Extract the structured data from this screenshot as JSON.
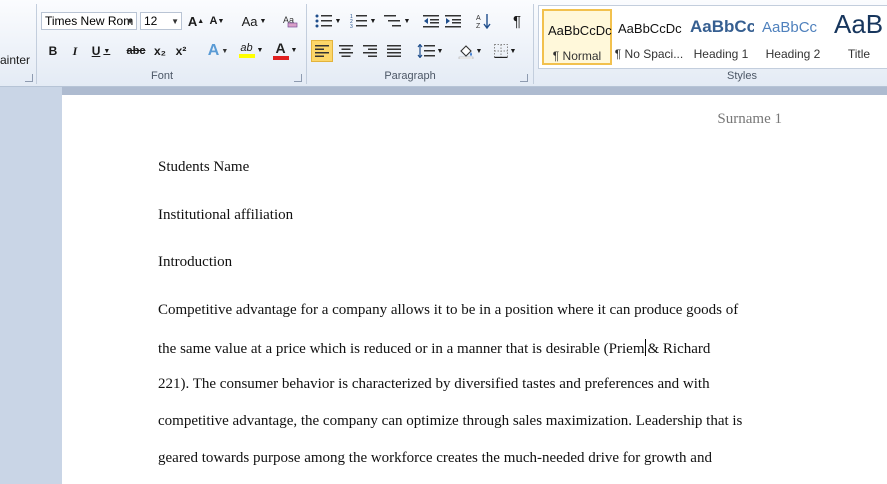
{
  "ribbon": {
    "clipboard_fragment": "ainter",
    "font": {
      "group_label": "Font",
      "font_name": "Times New Rom",
      "font_size": "12",
      "grow_font": "A",
      "shrink_font": "A",
      "change_case": "Aa",
      "bold": "B",
      "italic": "I",
      "underline": "U",
      "strikethrough": "abc",
      "subscript": "x₂",
      "superscript": "x²",
      "text_effects": "A",
      "highlight": "ab",
      "font_color": "A"
    },
    "paragraph": {
      "group_label": "Paragraph",
      "show_marks": "¶"
    },
    "styles": {
      "group_label": "Styles",
      "items": [
        {
          "sample": "AaBbCcDc",
          "name": "¶ Normal"
        },
        {
          "sample": "AaBbCcDc",
          "name": "¶ No Spaci..."
        },
        {
          "sample": "AaBbCc",
          "name": "Heading 1"
        },
        {
          "sample": "AaBbCc",
          "name": "Heading 2"
        },
        {
          "sample": "AaB",
          "name": "Title"
        }
      ]
    }
  },
  "colors": {
    "highlight": "#ffff00",
    "font_color": "#e02020",
    "heading": "#365f91",
    "selected_style": "#f2c14e"
  },
  "document": {
    "header": "Surname 1",
    "lines": [
      "Students Name",
      "Institutional affiliation",
      "Introduction",
      "Competitive advantage for a company allows it to be in a position where it can produce goods of",
      "the same value at a price which is reduced or in a manner that is desirable (Priem",
      "& Richard",
      "221). The consumer behavior is characterized by diversified tastes and preferences and with",
      "competitive advantage, the company can optimize through sales maximization.  Leadership that is",
      "geared towards purpose among the workforce creates the much-needed drive for growth and"
    ]
  }
}
